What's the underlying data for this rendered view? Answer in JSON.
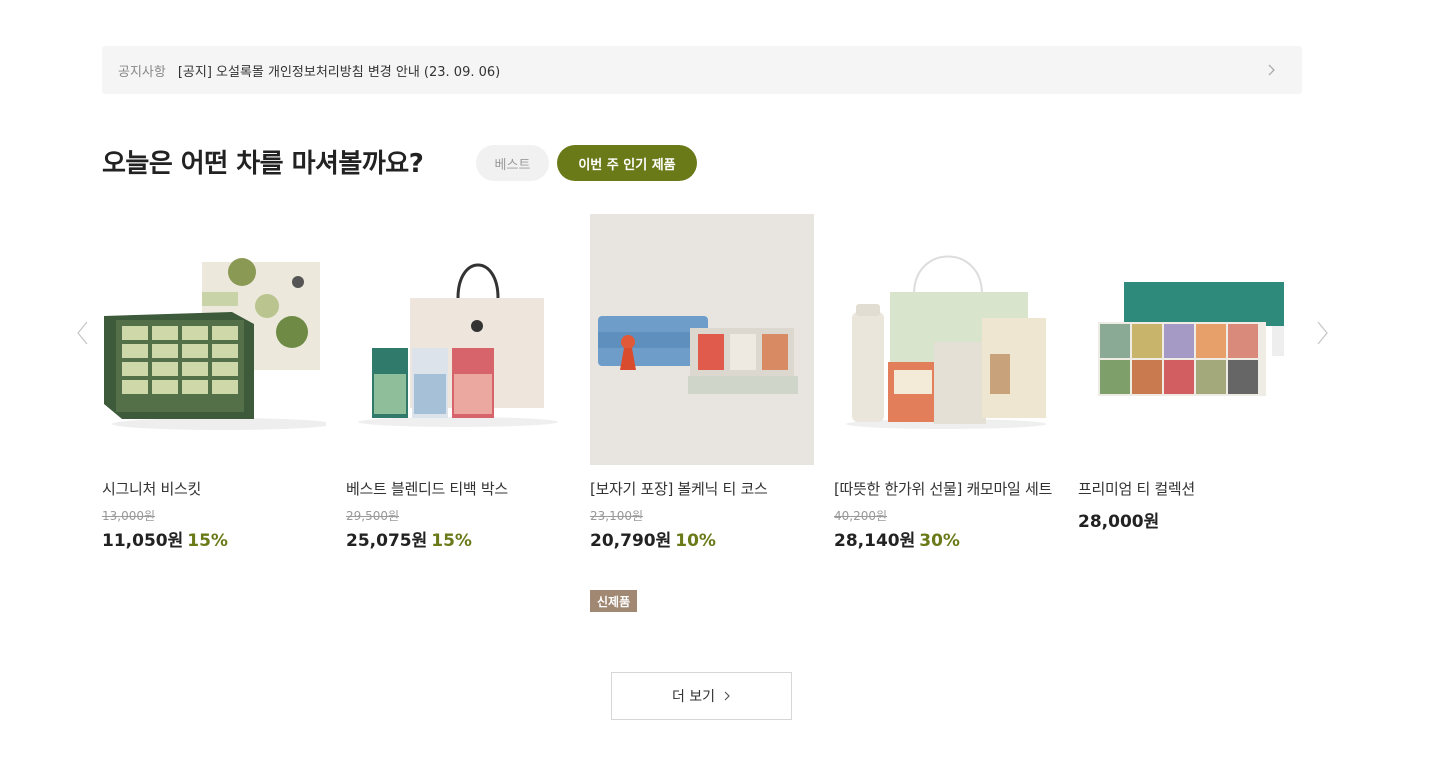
{
  "notice": {
    "label": "공지사항",
    "text": "[공지] 오설록몰 개인정보처리방침 변경 안내 (23. 09. 06)",
    "arrow_icon": "chevron-right-icon"
  },
  "section": {
    "title": "오늘은 어떤 차를 마셔볼까요?",
    "tabs": [
      {
        "label": "베스트",
        "active": false
      },
      {
        "label": "이번 주 인기 제품",
        "active": true
      }
    ]
  },
  "carousel": {
    "prev_icon": "chevron-left-icon",
    "next_icon": "chevron-right-icon"
  },
  "products": [
    {
      "name": "시그니처 비스킷",
      "original_price": "13,000원",
      "price": "11,050원",
      "discount": "15%",
      "badge": ""
    },
    {
      "name": "베스트 블렌디드 티백 박스",
      "original_price": "29,500원",
      "price": "25,075원",
      "discount": "15%",
      "badge": ""
    },
    {
      "name": "[보자기 포장] 볼케닉 티 코스",
      "original_price": "23,100원",
      "price": "20,790원",
      "discount": "10%",
      "badge": "신제품"
    },
    {
      "name": "[따뜻한 한가위 선물] 캐모마일 세트",
      "original_price": "40,200원",
      "price": "28,140원",
      "discount": "30%",
      "badge": ""
    },
    {
      "name": "프리미엄 티 컬렉션",
      "original_price": "",
      "price": "28,000원",
      "discount": "",
      "badge": ""
    }
  ],
  "more_button": {
    "label": "더 보기",
    "icon": "chevron-right-icon"
  },
  "colors": {
    "accent": "#6b7a18",
    "badge": "#a08873",
    "notice_bg": "#f5f5f5"
  }
}
